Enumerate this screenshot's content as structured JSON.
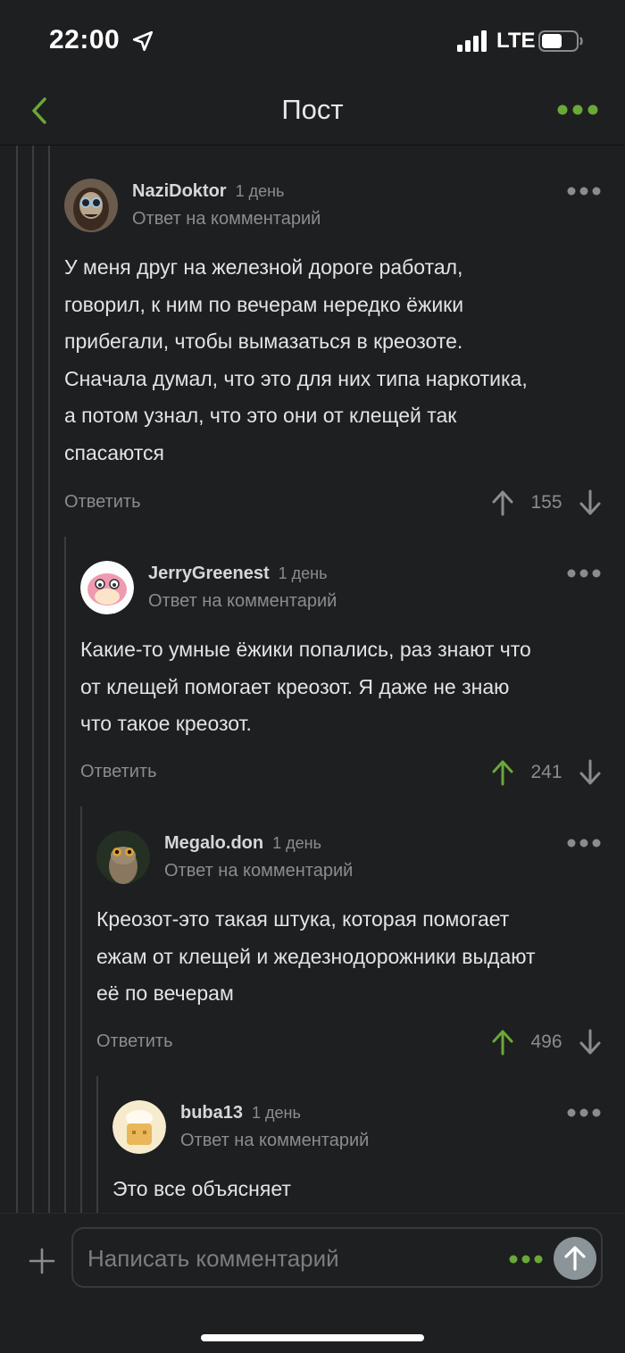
{
  "status": {
    "time": "22:00",
    "network": "LTE"
  },
  "nav": {
    "title": "Пост"
  },
  "comments": [
    {
      "author": "NaziDoktor",
      "time": "1 день",
      "reply_to": "Ответ на комментарий",
      "lines": [
        "У меня друг на железной дороге работал,",
        "говорил, к ним по вечерам нередко ёжики",
        "прибегали, чтобы вымазаться в креозоте.",
        "Сначала думал, что это для них типа наркотика,",
        "а потом узнал, что это они от клещей так",
        "спасаются"
      ],
      "reply_label": "Ответить",
      "score": "155",
      "upvoted": false
    },
    {
      "author": "JerryGreenest",
      "time": "1 день",
      "reply_to": "Ответ на комментарий",
      "lines": [
        "Какие-то умные ёжики попались, раз знают что",
        "от клещей помогает креозот. Я даже не знаю",
        "что такое креозот."
      ],
      "reply_label": "Ответить",
      "score": "241",
      "upvoted": true
    },
    {
      "author": "Megalo.don",
      "time": "1 день",
      "reply_to": "Ответ на комментарий",
      "lines": [
        "Креозот-это такая штука, которая помогает",
        "ежам от клещей и жедезнодорожники выдают",
        "её по вечерам"
      ],
      "reply_label": "Ответить",
      "score": "496",
      "upvoted": true
    },
    {
      "author": "buba13",
      "time": "1 день",
      "reply_to": "Ответ на комментарий",
      "lines": [
        "Это все объясняет"
      ]
    }
  ],
  "composer": {
    "placeholder": "Написать комментарий"
  },
  "colors": {
    "accent": "#6aa837",
    "muted": "#8b8c90",
    "background": "#1e1f21"
  }
}
